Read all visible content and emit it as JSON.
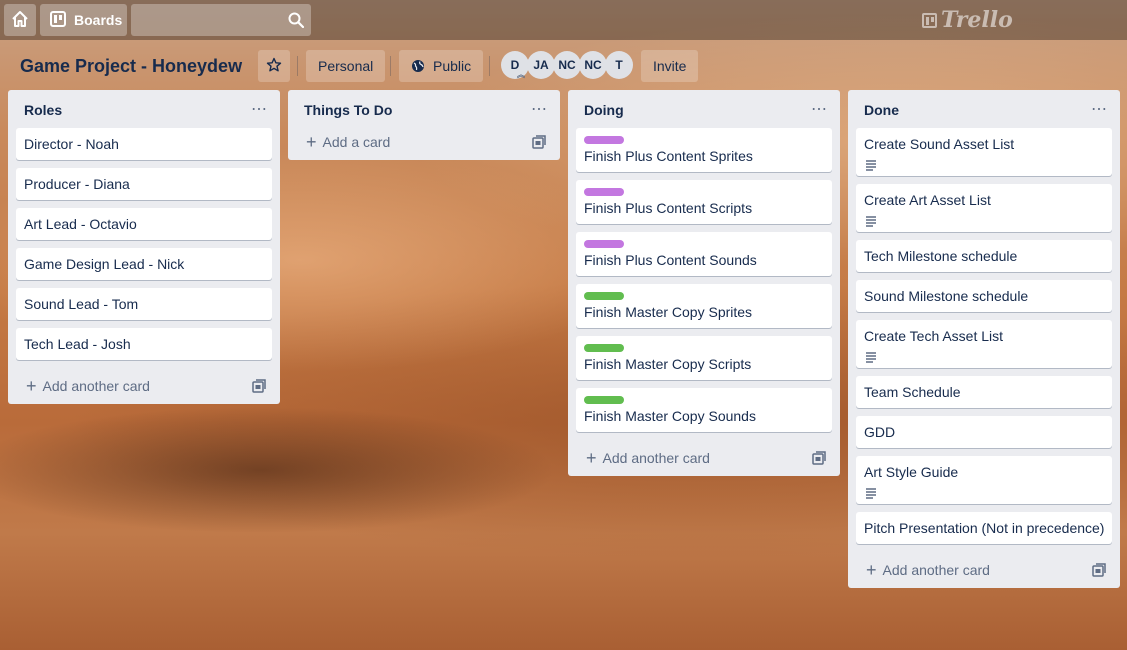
{
  "topbar": {
    "boards_label": "Boards",
    "search_placeholder": "",
    "logo_text": "Trello"
  },
  "header": {
    "title": "Game Project - Honeydew",
    "personal_label": "Personal",
    "public_label": "Public",
    "invite_label": "Invite",
    "members": [
      "D",
      "JA",
      "NC",
      "NC",
      "T"
    ]
  },
  "lists": [
    {
      "title": "Roles",
      "cards": [
        {
          "text": "Director - Noah"
        },
        {
          "text": "Producer - Diana"
        },
        {
          "text": "Art Lead - Octavio"
        },
        {
          "text": "Game Design Lead - Nick"
        },
        {
          "text": "Sound Lead - Tom"
        },
        {
          "text": "Tech Lead - Josh"
        }
      ],
      "add_label": "Add another card"
    },
    {
      "title": "Things To Do",
      "cards": [],
      "add_label": "Add a card"
    },
    {
      "title": "Doing",
      "cards": [
        {
          "text": "Finish Plus Content Sprites",
          "label_color": "#c377e0"
        },
        {
          "text": "Finish Plus Content Scripts",
          "label_color": "#c377e0"
        },
        {
          "text": "Finish Plus Content Sounds",
          "label_color": "#c377e0"
        },
        {
          "text": "Finish Master Copy Sprites",
          "label_color": "#61bd4f"
        },
        {
          "text": "Finish Master Copy Scripts",
          "label_color": "#61bd4f"
        },
        {
          "text": "Finish Master Copy Sounds",
          "label_color": "#61bd4f"
        }
      ],
      "add_label": "Add another card"
    },
    {
      "title": "Done",
      "cards": [
        {
          "text": "Create Sound Asset List",
          "has_description": true
        },
        {
          "text": "Create Art Asset List",
          "has_description": true
        },
        {
          "text": "Tech Milestone schedule"
        },
        {
          "text": "Sound Milestone schedule"
        },
        {
          "text": "Create Tech Asset List",
          "has_description": true
        },
        {
          "text": "Team Schedule"
        },
        {
          "text": "GDD"
        },
        {
          "text": "Art Style Guide",
          "has_description": true
        },
        {
          "text": "Pitch Presentation (Not in precedence)"
        }
      ],
      "add_label": "Add another card"
    }
  ]
}
